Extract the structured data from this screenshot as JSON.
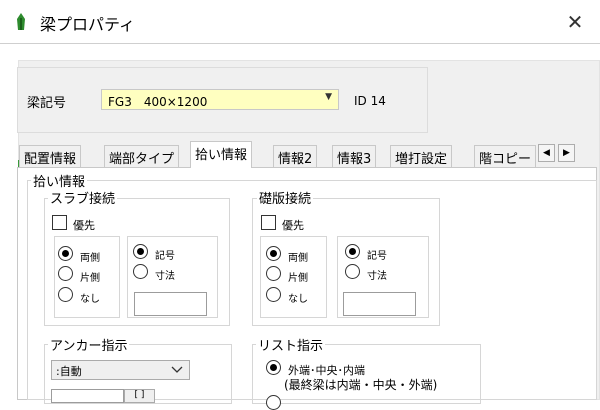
{
  "window": {
    "title": "梁プロパティ",
    "close_glyph": "✕"
  },
  "beam": {
    "label": "梁記号",
    "value": "FG3　400×1200",
    "id_label": "ID 14",
    "field_color": "#ffffc0"
  },
  "tabs": [
    "配置情報",
    "端部タイプ",
    "拾い情報",
    "情報2",
    "情報3",
    "増打設定",
    "階コピー"
  ],
  "active_tab": 2,
  "scroll": {
    "left": "◀",
    "right": "▶"
  },
  "pick": {
    "group_label": "拾い情報",
    "slab": {
      "label": "スラブ接続",
      "priority": "優先",
      "sides": [
        "両側",
        "片側",
        "なし"
      ],
      "mode": [
        "記号",
        "寸法"
      ]
    },
    "bed": {
      "label": "礎版接続",
      "priority": "優先",
      "sides": [
        "両側",
        "片側",
        "なし"
      ],
      "mode": [
        "記号",
        "寸法"
      ]
    },
    "anchor": {
      "label": "アンカー指示",
      "value": ":自動",
      "btn": "[ ]"
    },
    "list": {
      "label": "リスト指示",
      "opt1_line1": "外端･中央･内端",
      "opt1_line2": "(最終梁は内端・中央・外端)"
    }
  }
}
